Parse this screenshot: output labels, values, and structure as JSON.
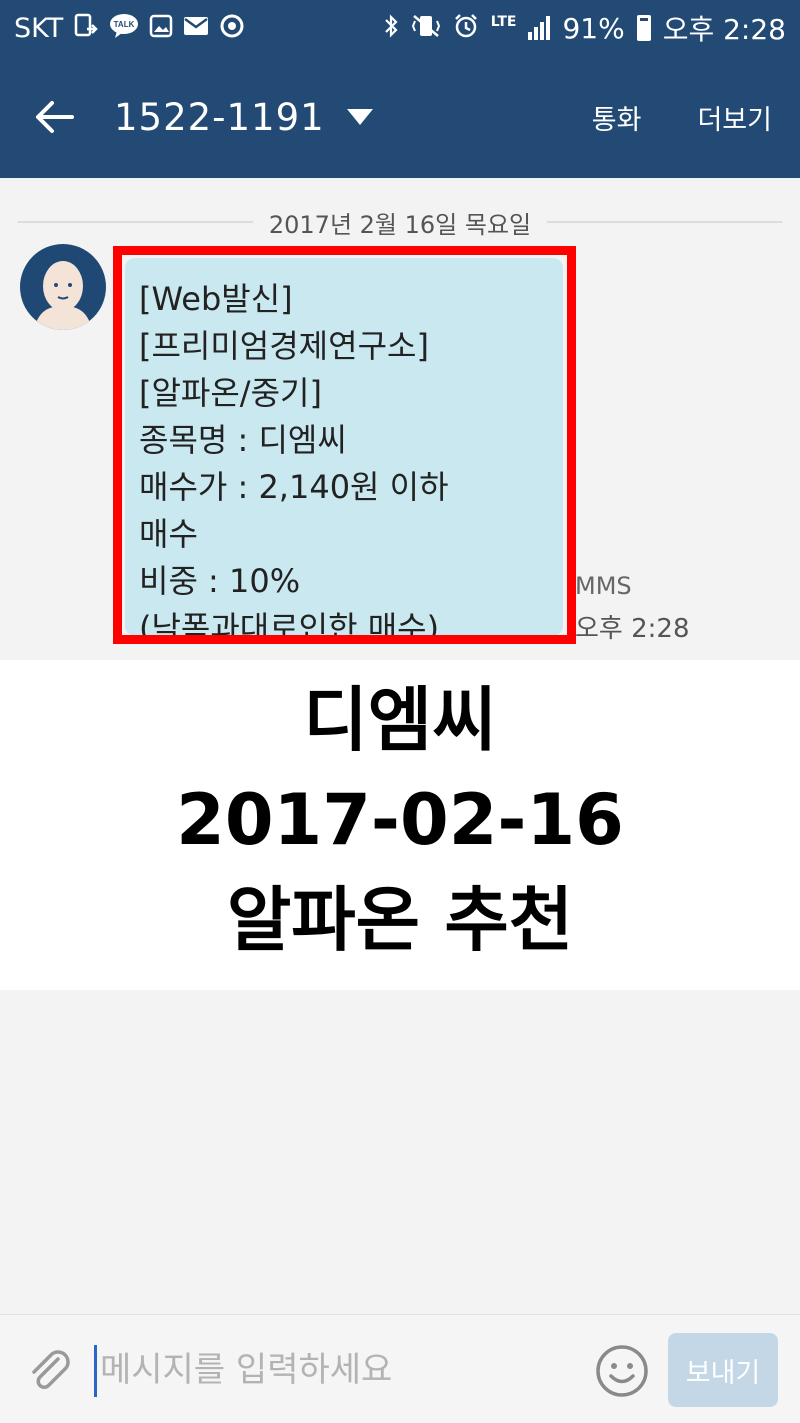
{
  "status_bar": {
    "carrier": "SKT",
    "lte": "LTE",
    "battery": "91%",
    "time": "오후 2:28",
    "icons": [
      "screen-mirror-icon",
      "kakaotalk-icon",
      "gallery-icon",
      "mail-icon",
      "sync-icon",
      "bluetooth-icon",
      "vibrate-icon",
      "alarm-icon",
      "signal-icon",
      "battery-icon"
    ]
  },
  "toolbar": {
    "title": "1522-1191",
    "call_label": "통화",
    "more_label": "더보기"
  },
  "conversation": {
    "date": "2017년 2월 16일 목요일",
    "message": {
      "lines": [
        "[Web발신]",
        "[프리미엄경제연구소]",
        "[알파온/중기]",
        "종목명 : 디엠씨",
        "매수가 : 2,140원 이하",
        "매수",
        "비중 : 10%",
        "(낙폭과대로인한 매수)"
      ],
      "type": "MMS",
      "time": "오후 2:28"
    }
  },
  "caption": {
    "line1": "디엠씨",
    "line2": "2017-02-16",
    "line3": "알파온 추천"
  },
  "input_bar": {
    "placeholder": "메시지를 입력하세요",
    "value": "",
    "send_label": "보내기"
  },
  "colors": {
    "header": "#234a74",
    "bubble": "#c9e8ef",
    "highlight": "#ff0000",
    "send_button": "#c3d7e6"
  }
}
